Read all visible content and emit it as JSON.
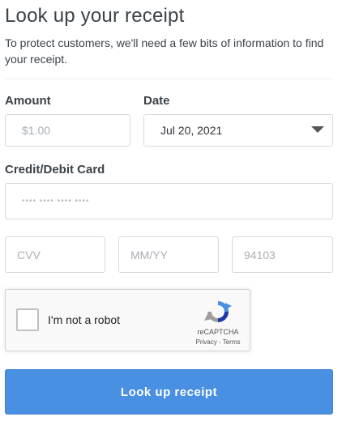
{
  "page": {
    "title": "Look up your receipt",
    "intro": "To protect customers, we'll need a few bits of information to find your receipt."
  },
  "form": {
    "amount_label": "Amount",
    "amount_placeholder": "$1.00",
    "date_label": "Date",
    "date_value": "Jul 20, 2021",
    "card_label": "Credit/Debit Card",
    "card_placeholder": "•••• •••• •••• ••••",
    "cvv_placeholder": "CVV",
    "expiry_placeholder": "MM/YY",
    "zip_placeholder": "94103"
  },
  "captcha": {
    "checkbox_label": "I'm not a robot",
    "brand": "reCAPTCHA",
    "links": "Privacy - Terms",
    "icon": "recaptcha-icon"
  },
  "submit": {
    "label": "Look up receipt"
  },
  "colors": {
    "button": "#4a90e2",
    "border": "#d4d9dd"
  }
}
